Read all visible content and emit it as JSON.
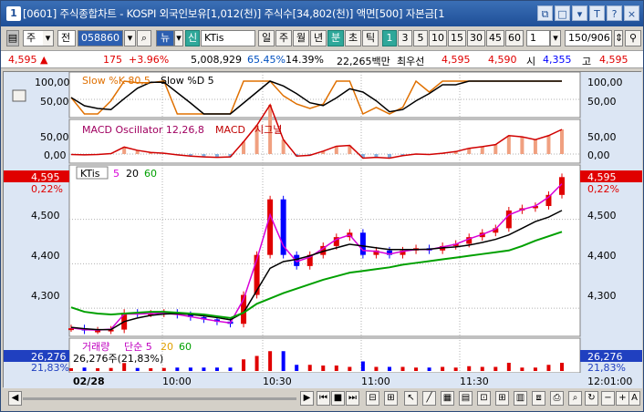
{
  "window": {
    "title": "[0601] 주식종합차트 - KOSPI 외국인보유[1,012(천)] 주식수[34,802(천)] 액면[500] 자본금[1",
    "icon_label": "1",
    "buttons": [
      "⧉",
      "□",
      "▾",
      "T",
      "?",
      "×"
    ]
  },
  "toolbar": {
    "market": "주",
    "category": "전",
    "code": "058860",
    "news_label": "뉴",
    "new_label": "신",
    "stock_name": "KTis",
    "periods": [
      "일",
      "주",
      "월",
      "년",
      "분",
      "초",
      "틱"
    ],
    "active_period": "분",
    "intervals": [
      "1",
      "3",
      "5",
      "10",
      "15",
      "30",
      "45",
      "60"
    ],
    "active_interval": "1",
    "count": "1",
    "page": "150/906"
  },
  "quote": {
    "price": "4,595",
    "change": "175",
    "change_pct": "+3.96%",
    "volume": "5,008,929",
    "vol_ratio": "65.45%",
    "turnover": "14.39%",
    "amount": "22,265백만",
    "best_label": "최우선",
    "ask": "4,595",
    "bid": "4,590",
    "open_label": "시",
    "open": "4,355",
    "high_label": "고",
    "high": "4,595"
  },
  "colors": {
    "up": "#e00000",
    "down": "#0000ff",
    "ma5": "#d800d8",
    "ma20": "#000000",
    "ma60": "#00a000",
    "grid": "#b0b0b0"
  },
  "panels": {
    "stoch": {
      "title": "Slow %K 80,5",
      "title2": "Slow %D 5",
      "axis": [
        "100,00",
        "50,00"
      ]
    },
    "macd": {
      "title": "MACD Oscillator 12,26,8",
      "title2": "MACD",
      "title3": "시그널",
      "axis": [
        "50,00",
        "0,00"
      ]
    },
    "price": {
      "name": "KTis",
      "ma": [
        "5",
        "20",
        "60"
      ],
      "axis": [
        "4,500",
        "4,400",
        "4,300"
      ],
      "tag_price": "4,595",
      "tag_pct": "0,22%",
      "tag_top": "4,595"
    },
    "volume": {
      "title": "거래량",
      "title2": "단순 5",
      "ma": [
        "20",
        "60"
      ],
      "info": "26,276주(21,83%)",
      "tag_vol": "26,276",
      "tag_pct": "21,83%"
    }
  },
  "time_axis": {
    "date": "02/28",
    "ticks": [
      "10:00",
      "10:30",
      "11:00",
      "11:30"
    ],
    "right": "12:01:00"
  },
  "chart_data": {
    "type": "line",
    "series": [
      {
        "name": "KTis",
        "values": [
          4255,
          4250,
          4250,
          4252,
          4290,
          4288,
          4288,
          4290,
          4285,
          4280,
          4275,
          4270,
          4265,
          4330,
          4420,
          4545,
          4420,
          4395,
          4420,
          4440,
          4460,
          4470,
          4420,
          4430,
          4420,
          4430,
          4435,
          4430,
          4440,
          4445,
          4460,
          4470,
          4480,
          4520,
          4525,
          4530,
          4555,
          4595
        ]
      },
      {
        "name": "5",
        "values": [
          4256,
          4252,
          4251,
          4253,
          4287,
          4287,
          4288,
          4289,
          4286,
          4281,
          4276,
          4271,
          4267,
          4320,
          4410,
          4510,
          4440,
          4405,
          4415,
          4435,
          4455,
          4465,
          4430,
          4428,
          4422,
          4428,
          4432,
          4432,
          4438,
          4444,
          4456,
          4466,
          4478,
          4510,
          4522,
          4530,
          4550,
          4580
        ]
      },
      {
        "name": "20",
        "values": [
          4257,
          4254,
          4252,
          4252,
          4270,
          4278,
          4284,
          4287,
          4288,
          4286,
          4283,
          4279,
          4274,
          4290,
          4340,
          4390,
          4405,
          4410,
          4418,
          4428,
          4436,
          4444,
          4440,
          4436,
          4432,
          4432,
          4432,
          4433,
          4436,
          4438,
          4442,
          4448,
          4455,
          4465,
          4480,
          4495,
          4505,
          4520
        ]
      },
      {
        "name": "60",
        "values": [
          4302,
          4292,
          4288,
          4286,
          4288,
          4290,
          4292,
          4292,
          4290,
          4288,
          4286,
          4282,
          4278,
          4290,
          4310,
          4322,
          4334,
          4344,
          4354,
          4364,
          4372,
          4380,
          4384,
          4388,
          4392,
          4398,
          4402,
          4406,
          4410,
          4414,
          4418,
          4422,
          4426,
          4430,
          4440,
          4452,
          4462,
          4472
        ]
      }
    ],
    "ylim": [
      4245,
      4610
    ]
  }
}
